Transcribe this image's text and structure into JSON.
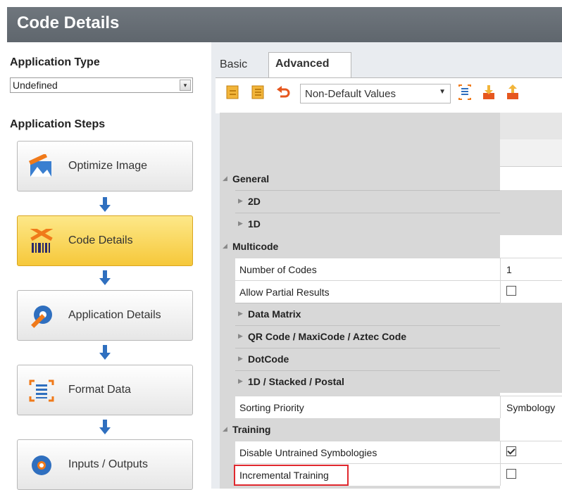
{
  "window": {
    "title": "Code Details"
  },
  "left": {
    "application_type_label": "Application Type",
    "application_type_value": "Undefined",
    "application_steps_label": "Application Steps",
    "steps": [
      {
        "label": "Optimize Image",
        "icon": "wrench-image-icon",
        "active": false
      },
      {
        "label": "Code Details",
        "icon": "tools-barcode-icon",
        "active": true
      },
      {
        "label": "Application Details",
        "icon": "gear-wrench-icon",
        "active": false
      },
      {
        "label": "Format Data",
        "icon": "format-data-icon",
        "active": false
      },
      {
        "label": "Inputs / Outputs",
        "icon": "gear-icon",
        "active": false
      }
    ]
  },
  "tabs": [
    {
      "label": "Basic"
    },
    {
      "label": "Advanced"
    }
  ],
  "toolbar": {
    "filter_value": "Non-Default Values",
    "icons": [
      "document-icon",
      "document-copy-icon",
      "undo-icon",
      "list-icon",
      "import-icon",
      "export-icon"
    ]
  },
  "properties": {
    "general": {
      "label": "General",
      "items": [
        {
          "label": "2D"
        },
        {
          "label": "1D"
        }
      ]
    },
    "multicode": {
      "label": "Multicode",
      "number_of_codes": {
        "label": "Number of Codes",
        "value": "1"
      },
      "allow_partial": {
        "label": "Allow Partial Results",
        "checked": false
      },
      "subgroups": [
        {
          "label": "Data Matrix"
        },
        {
          "label": "QR Code / MaxiCode / Aztec Code"
        },
        {
          "label": "DotCode"
        },
        {
          "label": "1D / Stacked / Postal"
        }
      ],
      "sorting_priority": {
        "label": "Sorting Priority",
        "value": "Symbology"
      }
    },
    "training": {
      "label": "Training",
      "disable_untrained": {
        "label": "Disable Untrained Symbologies",
        "checked": true
      },
      "incremental": {
        "label": "Incremental Training",
        "checked": false
      }
    }
  },
  "colors": {
    "title_bar": "#666d74",
    "active_step": "#f8d24e",
    "arrow": "#2f6fbf",
    "highlight": "#e0282e"
  }
}
